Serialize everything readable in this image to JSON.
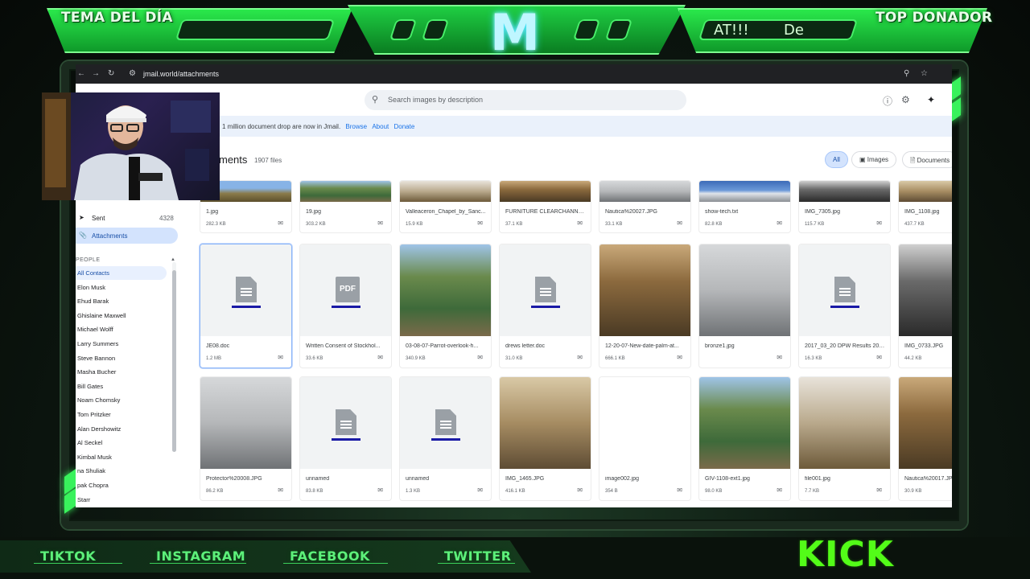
{
  "overlay": {
    "left_title": "TEMA DEL DÍA",
    "right_title": "TOP DONADOR",
    "ticker_left": "AT!!!",
    "ticker_right": "De",
    "logo": "M",
    "socials": [
      "TIKTOK",
      "INSTAGRAM",
      "FACEBOOK",
      "TWITTER"
    ],
    "kick": "KICK",
    "accent_color": "#39f25c"
  },
  "browser": {
    "url": "jmail.world/attachments",
    "search_placeholder": "Search images by description",
    "notice_text": "1 million document drop are now in Jmail.",
    "notice_links": [
      "Browse",
      "About",
      "Donate"
    ],
    "page_title": "ments",
    "file_count": "1907 files",
    "filters": [
      "All",
      "Images",
      "Documents"
    ]
  },
  "sidebar": {
    "items": [
      {
        "label": "Sent",
        "count": "4328"
      },
      {
        "label": "Attachments",
        "count": ""
      }
    ],
    "people_header": "PEOPLE",
    "contacts": [
      "All Contacts",
      "Elon Musk",
      "Ehud Barak",
      "Ghislaine Maxwell",
      "Michael Wolff",
      "Larry Summers",
      "Steve Bannon",
      "Masha Bucher",
      "Bill Gates",
      "Noam Chomsky",
      "Tom Pritzker",
      "Alan Dershowitz",
      "Al Seckel",
      "Kimbal Musk",
      "na Shuliak",
      "pak Chopra",
      "Starr"
    ]
  },
  "files": {
    "row0": [
      {
        "name": "1.jpg",
        "size": "282.3 KB"
      },
      {
        "name": "19.jpg",
        "size": "303.2 KB"
      },
      {
        "name": "Valleaceron_Chapel_by_Sanc...",
        "size": "15.9 KB"
      },
      {
        "name": "FURNITURE CLEARCHANNE...",
        "size": "37.1 KB"
      },
      {
        "name": "Nautica%20027.JPG",
        "size": "33.1 KB"
      },
      {
        "name": "show-tech.txt",
        "size": "82.8 KB"
      },
      {
        "name": "IMG_7305.jpg",
        "size": "115.7 KB"
      },
      {
        "name": "IMG_1108.jpg",
        "size": "437.7 KB"
      }
    ],
    "row1": [
      {
        "name": "JE08.doc",
        "size": "1.2 MB",
        "icon": "doc"
      },
      {
        "name": "Written Consent of Stockhol...",
        "size": "33.6 KB",
        "icon": "pdf"
      },
      {
        "name": "03-08-07-Parrot-overlook-h...",
        "size": "340.9 KB",
        "icon": "photo"
      },
      {
        "name": "drews letter.doc",
        "size": "31.0 KB",
        "icon": "doc"
      },
      {
        "name": "12-20-07-New-date-palm-at...",
        "size": "666.1 KB",
        "icon": "photo"
      },
      {
        "name": "bronze1.jpg",
        "size": "",
        "icon": "photo"
      },
      {
        "name": "2017_03_20 DPW Results 201...",
        "size": "16.3 KB",
        "icon": "doc"
      },
      {
        "name": "IMG_0733.JPG",
        "size": "44.2 KB",
        "icon": "photo"
      }
    ],
    "row2": [
      {
        "name": "Protector%20008.JPG",
        "size": "86.2 KB",
        "icon": "photo"
      },
      {
        "name": "unnamed",
        "size": "83.8 KB",
        "icon": "doc"
      },
      {
        "name": "unnamed",
        "size": "1.3 KB",
        "icon": "doc"
      },
      {
        "name": "IMG_1465.JPG",
        "size": "416.1 KB",
        "icon": "photo"
      },
      {
        "name": "image002.jpg",
        "size": "354 B",
        "icon": "blank"
      },
      {
        "name": "GIV-1108-ext1.jpg",
        "size": "98.0 KB",
        "icon": "photo"
      },
      {
        "name": "file001.jpg",
        "size": "7.7 KB",
        "icon": "photo"
      },
      {
        "name": "Nautica%20017.JPG",
        "size": "30.9 KB",
        "icon": "photo"
      }
    ]
  }
}
